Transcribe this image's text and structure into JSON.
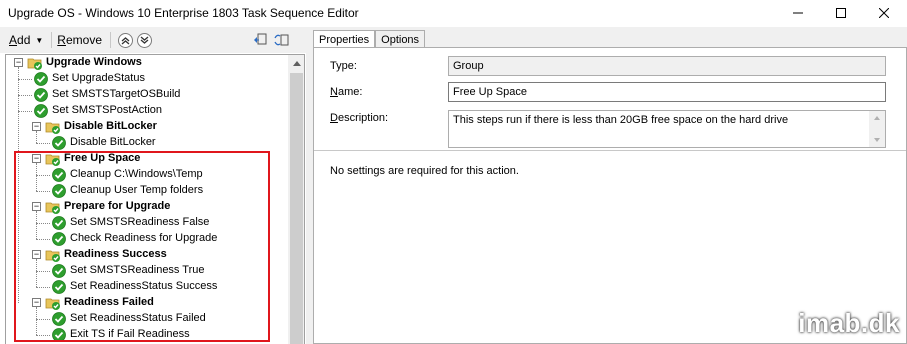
{
  "window": {
    "title": "Upgrade OS - Windows 10 Enterprise 1803 Task Sequence Editor",
    "minimize_icon": "minimize-icon",
    "maximize_icon": "maximize-icon",
    "close_icon": "close-icon"
  },
  "toolbar": {
    "add_label": "Add",
    "add_underline": "A",
    "add_rest": "dd",
    "remove_label": "Remove",
    "remove_underline": "R",
    "remove_rest": "emove",
    "move_up_icon": "move-up-icon",
    "move_down_icon": "move-down-icon",
    "icon3": "refresh-icon",
    "icon4": "bookmark-icon"
  },
  "tree": {
    "items": [
      {
        "label": "Upgrade Windows",
        "bold": true,
        "type": "group",
        "level": 0
      },
      {
        "label": "Set UpgradeStatus",
        "bold": false,
        "type": "step",
        "level": 1
      },
      {
        "label": "Set SMSTSTargetOSBuild",
        "bold": false,
        "type": "step",
        "level": 1
      },
      {
        "label": "Set SMSTSPostAction",
        "bold": false,
        "type": "step",
        "level": 1
      },
      {
        "label": "Disable BitLocker",
        "bold": true,
        "type": "group",
        "level": 1
      },
      {
        "label": "Disable BitLocker",
        "bold": false,
        "type": "step",
        "level": 2
      },
      {
        "label": "Free Up Space",
        "bold": true,
        "type": "group",
        "level": 1
      },
      {
        "label": "Cleanup C:\\Windows\\Temp",
        "bold": false,
        "type": "step",
        "level": 2
      },
      {
        "label": "Cleanup User Temp folders",
        "bold": false,
        "type": "step",
        "level": 2
      },
      {
        "label": "Prepare for Upgrade",
        "bold": true,
        "type": "group",
        "level": 1
      },
      {
        "label": "Set SMSTSReadiness False",
        "bold": false,
        "type": "step",
        "level": 2
      },
      {
        "label": "Check Readiness for Upgrade",
        "bold": false,
        "type": "step",
        "level": 2
      },
      {
        "label": "Readiness Success",
        "bold": true,
        "type": "group",
        "level": 1
      },
      {
        "label": "Set SMSTSReadiness True",
        "bold": false,
        "type": "step",
        "level": 2
      },
      {
        "label": "Set ReadinessStatus Success",
        "bold": false,
        "type": "step",
        "level": 2
      },
      {
        "label": "Readiness Failed",
        "bold": true,
        "type": "group",
        "level": 1
      },
      {
        "label": "Set ReadinessStatus Failed",
        "bold": false,
        "type": "step",
        "level": 2
      },
      {
        "label": "Exit TS if Fail Readiness",
        "bold": false,
        "type": "step",
        "level": 2
      }
    ],
    "group_icon": "folder-check-icon",
    "step_icon": "green-check-icon"
  },
  "tabs": [
    {
      "label": "Properties",
      "active": true
    },
    {
      "label": "Options",
      "active": false
    }
  ],
  "properties": {
    "type_label": "Type:",
    "type_value": "Group",
    "name_label": "Name:",
    "name_value": "Free Up Space",
    "description_label": "Description:",
    "description_value": "This steps run if there is less than 20GB free space on the hard drive",
    "message": "No settings are required  for this action."
  },
  "watermark": "imab.dk",
  "colors": {
    "highlight_border": "#e0161c",
    "check_green": "#2e9e2e",
    "folder_yellow": "#e8c55a"
  }
}
